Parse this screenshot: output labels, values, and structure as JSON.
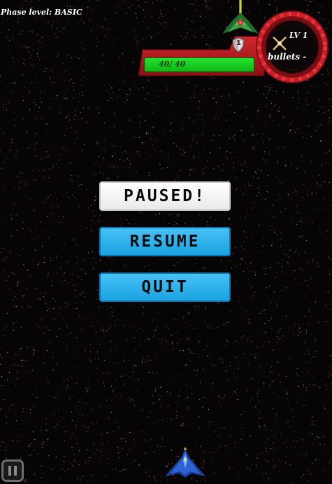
{
  "hud": {
    "phase_label": "Phase level: BASIC",
    "health_text": "40/ 40",
    "health_fraction": 1.0,
    "level_text": "LV 1",
    "bullets_text": "bullets -",
    "shield_count": "1"
  },
  "menu": {
    "paused_label": "PAUSED!",
    "resume_label": "RESUME",
    "quit_label": "QUIT"
  },
  "colors": {
    "background": "#060404",
    "hud_red": "#b81a1f",
    "hp_green": "#1ed224",
    "button_blue": "#2bb2ed",
    "paused_white": "#f4f4f4"
  },
  "icons": {
    "pause_button": "pause-icon",
    "shield": "shield-icon",
    "weapon": "crossed-swords-icon",
    "enemy": "enemy-ship-icon",
    "player": "player-ship-icon"
  }
}
